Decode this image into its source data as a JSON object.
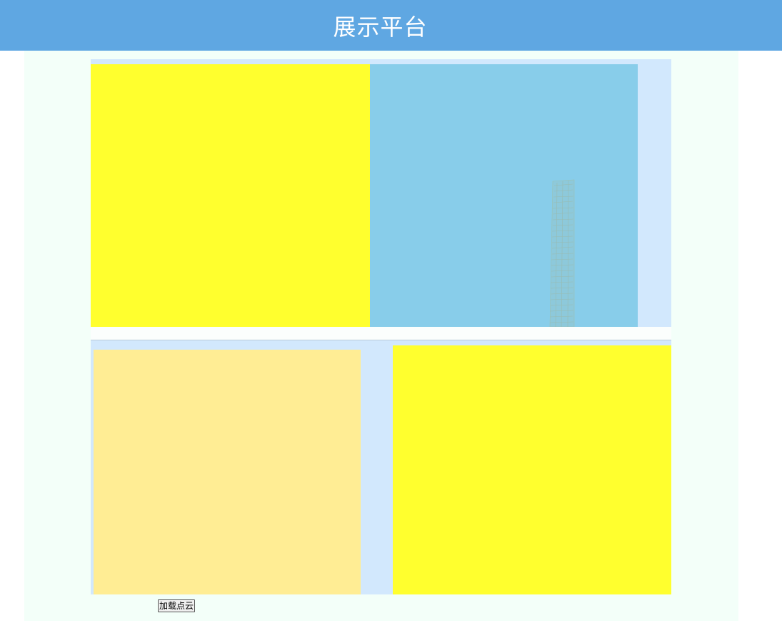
{
  "header": {
    "title": "展示平台"
  },
  "controls": {
    "load_button_label": "加载点云"
  },
  "views": {
    "top_left": {
      "color": "#ffff2e"
    },
    "top_right": {
      "color": "#88cdea",
      "content": "point-cloud-object"
    },
    "bottom_left": {
      "color": "#ffed94"
    },
    "bottom_right": {
      "color": "#ffff2e"
    }
  },
  "colors": {
    "header_bg": "#5fa7e2",
    "page_bg": "#f3fff9",
    "panel_bg": "#d2e8fd"
  }
}
